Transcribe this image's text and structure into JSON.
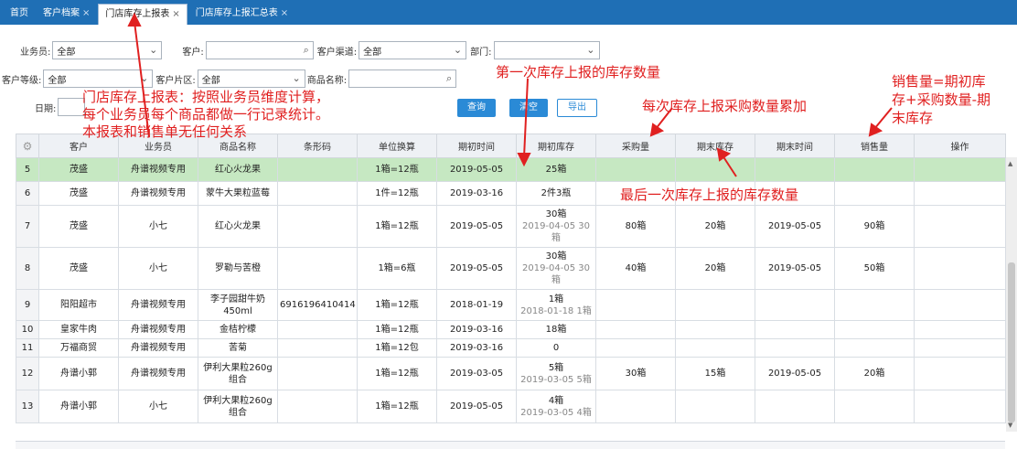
{
  "tabs": [
    {
      "label": "首页",
      "closable": false,
      "active": false
    },
    {
      "label": "客户档案",
      "closable": true,
      "active": false
    },
    {
      "label": "门店库存上报表",
      "closable": true,
      "active": true
    },
    {
      "label": "门店库存上报汇总表",
      "closable": true,
      "active": false
    }
  ],
  "filters": {
    "salesman_label": "业务员:",
    "salesman_value": "全部",
    "customer_label": "客户:",
    "customer_value": "",
    "channel_label": "客户渠道:",
    "channel_value": "全部",
    "dept_label": "部门:",
    "dept_value": "",
    "level_label": "客户等级:",
    "level_value": "全部",
    "area_label": "客户片区:",
    "area_value": "全部",
    "product_label": "商品名称:",
    "product_value": "",
    "date_label": "日期:",
    "date_value": ""
  },
  "buttons": {
    "query": "查询",
    "clear": "清空",
    "export": "导出"
  },
  "annotations": {
    "a1_line1": "门店库存上报表：按照业务员维度计算，",
    "a1_line2": "每个业务员每个商品都做一行记录统计。",
    "a1_line3": "本报表和销售单无任何关系",
    "a2": "第一次库存上报的库存数量",
    "a3": "每次库存上报采购数量累加",
    "a4": "最后一次库存上报的库存数量",
    "a5_line1": "销售量=期初库",
    "a5_line2": "存+采购数量-期",
    "a5_line3": "末库存"
  },
  "table": {
    "headers": [
      "客户",
      "业务员",
      "商品名称",
      "条形码",
      "单位换算",
      "期初时间",
      "期初库存",
      "采购量",
      "期末库存",
      "期末时间",
      "销售量",
      "操作"
    ],
    "rows": [
      {
        "idx": "5",
        "customer": "茂盛",
        "salesman": "舟谱视频专用",
        "product": "红心火龙果",
        "barcode": "",
        "unit": "1箱=12瓶",
        "start_time": "2019-05-05",
        "start_stock": "25箱",
        "start_stock_sub": "",
        "purchase": "",
        "end_stock": "",
        "end_time": "",
        "sales": "",
        "highlight": true
      },
      {
        "idx": "6",
        "customer": "茂盛",
        "salesman": "舟谱视频专用",
        "product": "蒙牛大果粒蓝莓",
        "barcode": "",
        "unit": "1件=12瓶",
        "start_time": "2019-03-16",
        "start_stock": "2件3瓶",
        "start_stock_sub": "",
        "purchase": "",
        "end_stock": "",
        "end_time": "",
        "sales": "",
        "highlight": false
      },
      {
        "idx": "7",
        "customer": "茂盛",
        "salesman": "小七",
        "product": "红心火龙果",
        "barcode": "",
        "unit": "1箱=12瓶",
        "start_time": "2019-05-05",
        "start_stock": "30箱",
        "start_stock_sub": "2019-04-05 30箱",
        "purchase": "80箱",
        "end_stock": "20箱",
        "end_time": "2019-05-05",
        "sales": "90箱",
        "highlight": false
      },
      {
        "idx": "8",
        "customer": "茂盛",
        "salesman": "小七",
        "product": "罗勒与苦橙",
        "barcode": "",
        "unit": "1箱=6瓶",
        "start_time": "2019-05-05",
        "start_stock": "30箱",
        "start_stock_sub": "2019-04-05 30箱",
        "purchase": "40箱",
        "end_stock": "20箱",
        "end_time": "2019-05-05",
        "sales": "50箱",
        "highlight": false
      },
      {
        "idx": "9",
        "customer": "阳阳超市",
        "salesman": "舟谱视频专用",
        "product": "李子园甜牛奶450ml",
        "barcode": "6916196410414",
        "unit": "1箱=12瓶",
        "start_time": "2018-01-19",
        "start_stock": "1箱",
        "start_stock_sub": "2018-01-18 1箱",
        "purchase": "",
        "end_stock": "",
        "end_time": "",
        "sales": "",
        "highlight": false
      },
      {
        "idx": "10",
        "customer": "皇家牛肉",
        "salesman": "舟谱视频专用",
        "product": "金桔柠檬",
        "barcode": "",
        "unit": "1箱=12瓶",
        "start_time": "2019-03-16",
        "start_stock": "18箱",
        "start_stock_sub": "",
        "purchase": "",
        "end_stock": "",
        "end_time": "",
        "sales": "",
        "highlight": false
      },
      {
        "idx": "11",
        "customer": "万福商贸",
        "salesman": "舟谱视频专用",
        "product": "苦菊",
        "barcode": "",
        "unit": "1箱=12包",
        "start_time": "2019-03-16",
        "start_stock": "0",
        "start_stock_sub": "",
        "purchase": "",
        "end_stock": "",
        "end_time": "",
        "sales": "",
        "highlight": false
      },
      {
        "idx": "12",
        "customer": "舟谱小郭",
        "salesman": "舟谱视频专用",
        "product": "伊利大果粒260g组合",
        "barcode": "",
        "unit": "1箱=12瓶",
        "start_time": "2019-03-05",
        "start_stock": "5箱",
        "start_stock_sub": "2019-03-05 5箱",
        "purchase": "30箱",
        "end_stock": "15箱",
        "end_time": "2019-05-05",
        "sales": "20箱",
        "highlight": false
      },
      {
        "idx": "13",
        "customer": "舟谱小郭",
        "salesman": "小七",
        "product": "伊利大果粒260g组合",
        "barcode": "",
        "unit": "1箱=12瓶",
        "start_time": "2019-05-05",
        "start_stock": "4箱",
        "start_stock_sub": "2019-03-05 4箱",
        "purchase": "",
        "end_stock": "",
        "end_time": "",
        "sales": "",
        "highlight": false
      }
    ]
  },
  "colors": {
    "accent": "#2a8ad6",
    "tabbar": "#1f6fb5",
    "highlight_row": "#c6e8c2",
    "annotation": "#e02020"
  },
  "icons": {
    "search": "search-icon",
    "chevron": "chevron-down-icon",
    "settings": "gear-icon"
  }
}
